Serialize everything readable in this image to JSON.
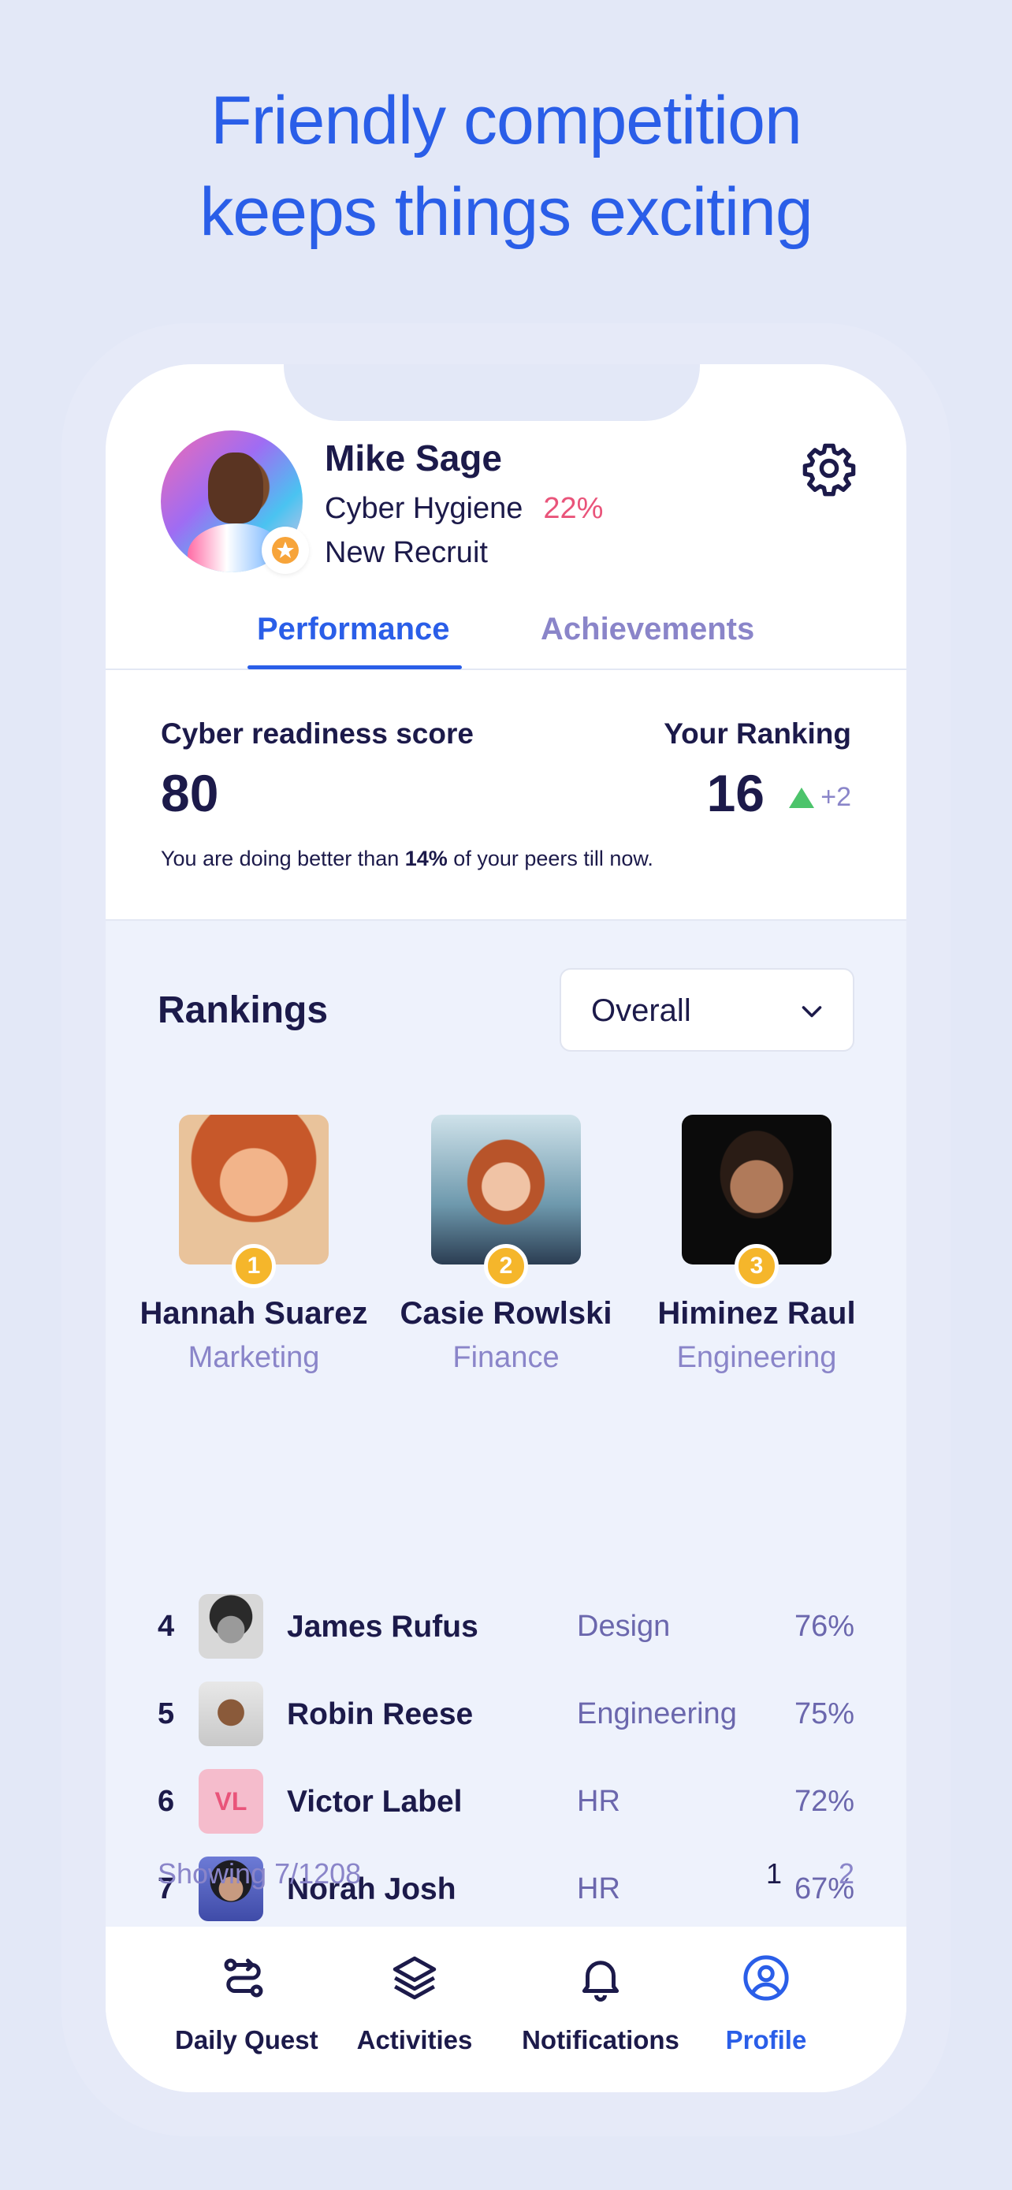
{
  "headline": [
    "Friendly competition",
    "keeps things exciting"
  ],
  "profile": {
    "name": "Mike Sage",
    "track": "Cyber Hygiene",
    "track_pct": "22%",
    "level": "New Recruit",
    "badge_icon": "star-icon",
    "settings_icon": "gear-icon"
  },
  "tabs": {
    "performance": "Performance",
    "achievements": "Achievements",
    "active": "Performance"
  },
  "score": {
    "readiness_label": "Cyber readiness score",
    "readiness_value": "80",
    "ranking_label": "Your Ranking",
    "ranking_value": "16",
    "ranking_change": "+2",
    "peer_prefix": "You are doing better than ",
    "peer_pct": "14%",
    "peer_suffix": " of your peers till now."
  },
  "rankings": {
    "title": "Rankings",
    "filter": "Overall",
    "top3": [
      {
        "rank": "1",
        "name": "Hannah Suarez",
        "dept": "Marketing"
      },
      {
        "rank": "2",
        "name": "Casie Rowlski",
        "dept": "Finance"
      },
      {
        "rank": "3",
        "name": "Himinez Raul",
        "dept": "Engineering"
      }
    ],
    "list": [
      {
        "rank": "4",
        "name": "James Rufus",
        "dept": "Design",
        "pct": "76%"
      },
      {
        "rank": "5",
        "name": "Robin Reese",
        "dept": "Engineering",
        "pct": "75%"
      },
      {
        "rank": "6",
        "name": "Victor Label",
        "dept": "HR",
        "pct": "72%",
        "initials": "VL"
      },
      {
        "rank": "7",
        "name": "Norah Josh",
        "dept": "HR",
        "pct": "67%"
      }
    ],
    "showing": "Showing 7/1208",
    "pages": [
      "1",
      "2"
    ]
  },
  "nav": {
    "daily_quest": "Daily Quest",
    "activities": "Activities",
    "notifications": "Notifications",
    "profile": "Profile",
    "active": "Profile"
  },
  "colors": {
    "accent": "#2a5ee8",
    "danger": "#e9547a",
    "medal": "#f5b62b",
    "up": "#4cc46b",
    "muted": "#8a85c9"
  }
}
